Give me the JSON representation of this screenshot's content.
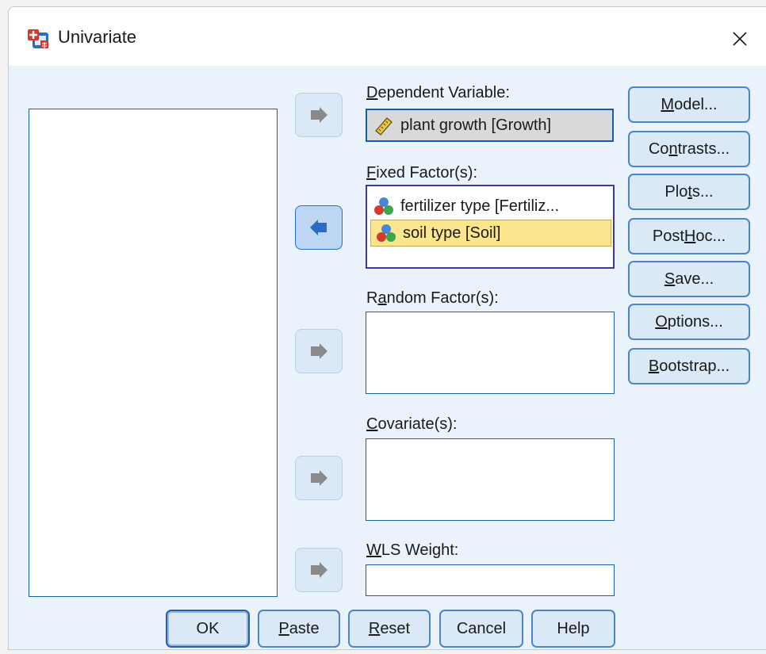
{
  "window": {
    "title": "Univariate",
    "icon": "spss-dialog-icon",
    "close_icon": "close-icon"
  },
  "variable_list": {
    "items": []
  },
  "dependent_variable": {
    "label_u": "D",
    "label_rest": "ependent Variable:",
    "value": "plant growth [Growth]",
    "icon": "scale-ruler-icon"
  },
  "fixed_factors": {
    "label_u": "F",
    "label_rest": "ixed Factor(s):",
    "items": [
      {
        "label": "fertilizer type [Fertiliz...",
        "icon": "nominal-balls-icon",
        "selected": false
      },
      {
        "label": "soil type [Soil]",
        "icon": "nominal-balls-icon",
        "selected": true
      }
    ]
  },
  "random_factors": {
    "label_pre": "R",
    "label_u": "a",
    "label_rest": "ndom Factor(s):"
  },
  "covariates": {
    "label_u": "C",
    "label_rest": "ovariate(s):"
  },
  "wls_weight": {
    "label_u": "W",
    "label_rest": "LS Weight:"
  },
  "side_buttons": [
    {
      "pre": "",
      "u": "M",
      "post": "odel..."
    },
    {
      "pre": "Co",
      "u": "n",
      "post": "trasts..."
    },
    {
      "pre": "Plo",
      "u": "t",
      "post": "s..."
    },
    {
      "pre": "Post ",
      "u": "H",
      "post": "oc..."
    },
    {
      "pre": "",
      "u": "S",
      "post": "ave..."
    },
    {
      "pre": "",
      "u": "O",
      "post": "ptions..."
    },
    {
      "pre": "",
      "u": "B",
      "post": "ootstrap..."
    }
  ],
  "bottom_buttons": {
    "ok": "OK",
    "paste_u": "P",
    "paste_rest": "aste",
    "reset_u": "R",
    "reset_rest": "eset",
    "cancel": "Cancel",
    "help": "Help"
  },
  "colors": {
    "dialog_bg": "#eaf2fb",
    "button_bg": "#dbe8f6",
    "button_border": "#4a86c8",
    "selection": "#fbe58d",
    "arrow_active": "#2a6cc0",
    "arrow_inactive": "#8a8a8a"
  }
}
